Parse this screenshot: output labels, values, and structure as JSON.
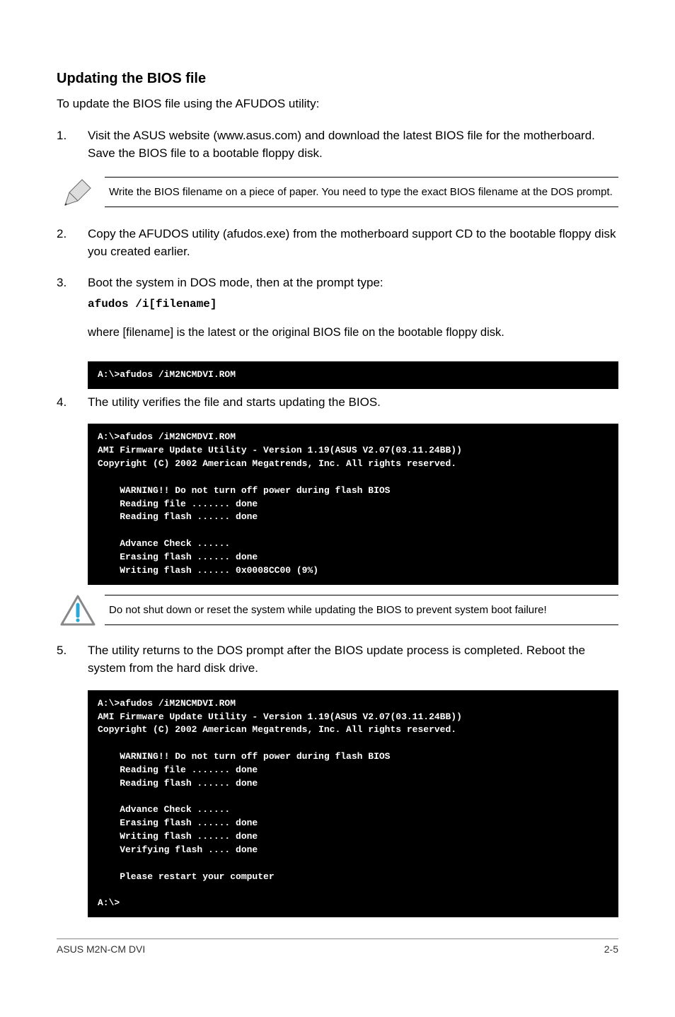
{
  "heading": "Updating the BIOS file",
  "intro": "To update the BIOS file using the AFUDOS utility:",
  "steps": {
    "s1": {
      "num": "1.",
      "text": "Visit the ASUS website (www.asus.com) and download the latest BIOS file for the motherboard. Save the BIOS file to a bootable floppy disk."
    },
    "s2": {
      "num": "2.",
      "text": "Copy the AFUDOS utility (afudos.exe) from the motherboard support CD to the bootable floppy disk you created earlier."
    },
    "s3": {
      "num": "3.",
      "text": "Boot the system in DOS mode, then at the prompt type:"
    },
    "s4": {
      "num": "4.",
      "text": "The utility verifies the file and starts updating the BIOS."
    },
    "s5": {
      "num": "5.",
      "text": "The utility returns to the DOS prompt after the BIOS update process is completed. Reboot the system from the hard disk drive."
    }
  },
  "note1": "Write the BIOS filename on a piece of paper. You need to type the exact BIOS filename at the DOS prompt.",
  "note2": "Do not shut down or reset the system while updating the BIOS to prevent system boot failure!",
  "cmd": "afudos /i[filename]",
  "where": "where [filename] is the latest or the original BIOS file on the bootable floppy disk.",
  "term1": "A:\\>afudos /iM2NCMDVI.ROM",
  "term2": "A:\\>afudos /iM2NCMDVI.ROM\nAMI Firmware Update Utility - Version 1.19(ASUS V2.07(03.11.24BB))\nCopyright (C) 2002 American Megatrends, Inc. All rights reserved.\n\n    WARNING!! Do not turn off power during flash BIOS\n    Reading file ....... done\n    Reading flash ...... done\n\n    Advance Check ......\n    Erasing flash ...... done\n    Writing flash ...... 0x0008CC00 (9%)",
  "term3": "A:\\>afudos /iM2NCMDVI.ROM\nAMI Firmware Update Utility - Version 1.19(ASUS V2.07(03.11.24BB))\nCopyright (C) 2002 American Megatrends, Inc. All rights reserved.\n\n    WARNING!! Do not turn off power during flash BIOS\n    Reading file ....... done\n    Reading flash ...... done\n\n    Advance Check ......\n    Erasing flash ...... done\n    Writing flash ...... done\n    Verifying flash .... done\n\n    Please restart your computer\n\nA:\\>",
  "footer": {
    "left": "ASUS M2N-CM DVI",
    "right": "2-5"
  }
}
